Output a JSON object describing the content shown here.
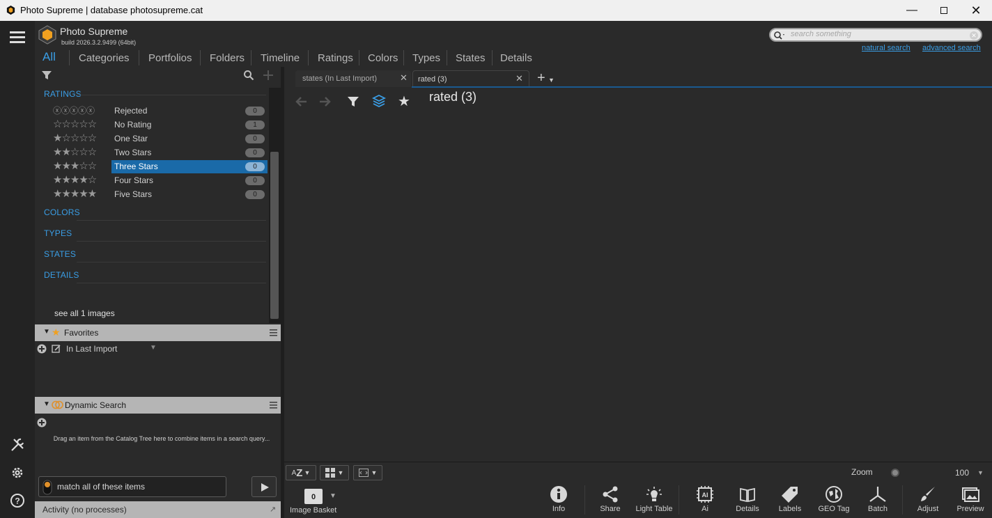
{
  "window": {
    "title": "Photo Supreme | database photosupreme.cat",
    "controls": [
      "minimize",
      "maximize",
      "close"
    ]
  },
  "app": {
    "name": "Photo Supreme",
    "build": "build 2026.3.2.9499 (64bit)"
  },
  "nav_tabs": [
    "All",
    "Categories",
    "Portfolios",
    "Folders",
    "Timeline",
    "Ratings",
    "Colors",
    "Types",
    "States",
    "Details"
  ],
  "search": {
    "placeholder": "search something",
    "natural": "natural search",
    "advanced": "advanced search"
  },
  "tree": {
    "ratings_title": "RATINGS",
    "ratings": [
      {
        "label": "Rejected",
        "count": "0",
        "stars": "rejected"
      },
      {
        "label": "No Rating",
        "count": "1",
        "stars": 0
      },
      {
        "label": "One Star",
        "count": "0",
        "stars": 1
      },
      {
        "label": "Two Stars",
        "count": "0",
        "stars": 2
      },
      {
        "label": "Three Stars",
        "count": "0",
        "stars": 3,
        "selected": true
      },
      {
        "label": "Four Stars",
        "count": "0",
        "stars": 4
      },
      {
        "label": "Five Stars",
        "count": "0",
        "stars": 5
      }
    ],
    "sections": [
      "COLORS",
      "TYPES",
      "STATES",
      "DETAILS"
    ],
    "see_all": "see all 1 images"
  },
  "favorites": {
    "title": "Favorites",
    "item": "In Last Import"
  },
  "dynamic_search": {
    "title": "Dynamic Search",
    "hint": "Drag an item from the Catalog Tree here to combine items in a search query...",
    "match": "match all of these items"
  },
  "activity": "Activity (no processes)",
  "doc_tabs": [
    {
      "label": "states (In Last Import)"
    },
    {
      "label": "rated  (3)",
      "active": true
    }
  ],
  "view": {
    "heading": "rated  (3)"
  },
  "zoom": {
    "label": "Zoom",
    "value": "100"
  },
  "basket": {
    "count": "0",
    "label": "Image Basket"
  },
  "tools": [
    "Info",
    "Share",
    "Light Table",
    "Ai",
    "Details",
    "Labels",
    "GEO Tag",
    "Batch",
    "Adjust",
    "Preview"
  ],
  "colors": {
    "accent": "#3a9ee6",
    "selection": "#1a6aa8",
    "logo": "#f0a020"
  }
}
